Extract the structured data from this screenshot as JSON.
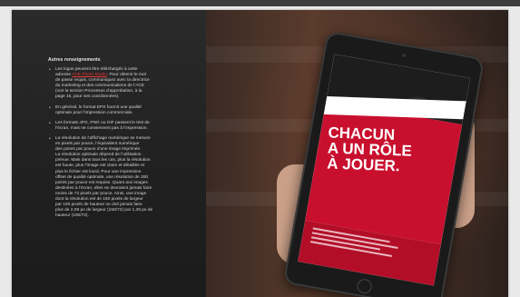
{
  "section": {
    "heading": "Autres renseignements",
    "bullets": [
      {
        "lines": [
          {
            "text": "Les logos peuvent être téléchargés à cette"
          },
          {
            "prefix": "adresse ",
            "link": "ACE Photo Studio",
            "suffix": ". Pour obtenir le mot"
          },
          {
            "text": "de passe requis, communiquez avec la directrice"
          },
          {
            "text": "du marketing et des communications de l’ACE"
          },
          {
            "text": "(voir la section Processus d’approbation, à la"
          },
          {
            "text": "page 15, pour ses coordonnées)."
          }
        ]
      },
      {
        "lines": [
          {
            "text": "En général, le format EPS fournit une qualité"
          },
          {
            "text": "optimale pour l’impression commerciale."
          }
        ]
      },
      {
        "lines": [
          {
            "text": "Les formats JPG, PNG ou GIF passent le test de"
          },
          {
            "text": "l’écran, mais ne conviennent pas à l’impression."
          }
        ]
      },
      {
        "lines": [
          {
            "text": "La résolution de l’affichage numérique se mesure"
          },
          {
            "text": "en pixels par pouce, l’équivalent numérique"
          },
          {
            "text": "des points par pouce d’une image imprimée."
          },
          {
            "text": "La résolution optimale dépend de l’utilisation"
          },
          {
            "text": "prévue. Mais dans tous les cas, plus la résolution"
          },
          {
            "text": "est haute, plus l’image est claire et détaillée et"
          },
          {
            "text": "plus le fichier est lourd. Pour une impression"
          },
          {
            "text": "offset de qualité optimale, une résolution de 300"
          },
          {
            "text": "points par pouce est requise. Quant aux images"
          },
          {
            "text": "destinées à l’écran, elles ne devraient jamais faire"
          },
          {
            "text": "moins de 72 pixels par pouce. Ainsi, une image"
          },
          {
            "text": "dont la résolution est de 150 pixels de largeur"
          },
          {
            "text": "par 100 pixels de hauteur ne doit jamais faire"
          },
          {
            "text": "plus de 2,08 po de largeur (150/72) par 1,39 po de"
          },
          {
            "text": "hauteur (100/72)."
          }
        ]
      }
    ]
  },
  "photo": {
    "brand": "SÉCURITÉ SPORT",
    "slogan": "CHACUN\nA UN RÔLE\nÀ JOUER."
  },
  "colors": {
    "link": "#e73a3a",
    "panel": "#222222",
    "poster_red": "#c8102e"
  }
}
